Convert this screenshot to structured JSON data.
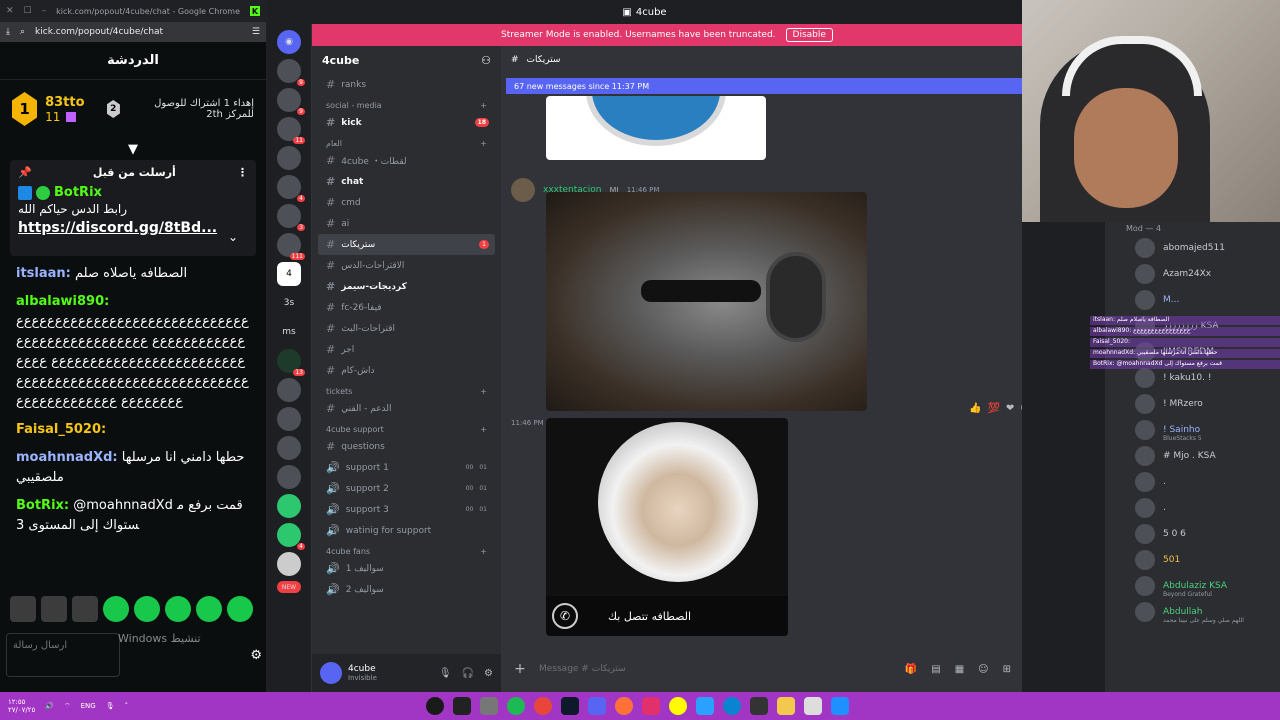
{
  "chrome": {
    "title": "kick.com/popout/4cube/chat - Google Chrome",
    "url": "kick.com/popout/4cube/chat"
  },
  "kick": {
    "header": "الدردشة",
    "leader": {
      "rank1": "1",
      "name": "83tto",
      "count": "11",
      "rank2": "2",
      "gift_text": "إهداء 1 اشتراك للوصول للمركز 2th"
    },
    "pinned": {
      "title": "أرسلت من قبل",
      "bot": "BotRix",
      "message": "رابط الدس حياكم الله",
      "link": "https://discord.gg/8tBd..."
    },
    "messages": [
      {
        "user": "itslaan:",
        "text": "الصطافه ياصلاه صلم"
      },
      {
        "user": "albalawi890:",
        "text": "ﻉﻉﻉﻉﻉﻉﻉﻉﻉﻉﻉﻉﻉﻉﻉﻉﻉﻉﻉﻉﻉﻉﻉﻉﻉﻉﻉﻉﻉﻉﻉﻉﻉﻉﻉﻉﻉﻉﻉﻉﻉﻉ ﻉﻉﻉﻉﻉﻉﻉﻉﻉﻉﻉﻉﻉﻉﻉﻉﻉﻉﻉﻉﻉﻉﻉﻉﻉﻉﻉﻉﻉﻉﻉﻉﻉﻉﻉﻉﻉﻉﻉﻉﻉﻉ ﻉﻉﻉﻉﻉﻉﻉﻉﻉﻉﻉﻉﻉﻉﻉﻉﻉﻉﻉﻉﻉﻉﻉﻉﻉﻉﻉﻉﻉﻉﻉﻉﻉﻉﻉﻉﻉﻉﻉﻉﻉﻉ ﻉﻉﻉﻉﻉﻉﻉﻉﻉﻉﻉﻉﻉ"
      },
      {
        "user": "Faisal_5020:",
        "text": ""
      },
      {
        "user": "moahnnadXd:",
        "text": "حطها دامني انا مرسلها ملصقيبي"
      },
      {
        "user": "BotRix:",
        "text": "@moahnnadXd قمت برفع مستواك إلى المستوى 3"
      }
    ],
    "send_placeholder": "ارسال رسالة",
    "watermark": "Windows تنشيط"
  },
  "discord": {
    "window_title": "4cube",
    "banner_text": "Streamer Mode is enabled. Usernames have been truncated.",
    "banner_button": "Disable",
    "guild_name": "4cube",
    "channels": [
      {
        "type": "text",
        "label": "ranks"
      },
      {
        "type": "category",
        "label": "social - media"
      },
      {
        "type": "text",
        "label": "kick",
        "bright": true,
        "mention": "18"
      },
      {
        "type": "category",
        "label": "العام"
      },
      {
        "type": "text",
        "label": "4cube ・لقطات"
      },
      {
        "type": "text",
        "label": "chat",
        "bright": true
      },
      {
        "type": "text",
        "label": "cmd"
      },
      {
        "type": "text",
        "label": "ai"
      },
      {
        "type": "text",
        "label": "ستريكات",
        "active": true,
        "mention": "1"
      },
      {
        "type": "text",
        "label": "الاقتراحات-الدس"
      },
      {
        "type": "text",
        "label": "كرديجات-سيمز",
        "bright": true
      },
      {
        "type": "text",
        "label": "fc-26-فيفا"
      },
      {
        "type": "text",
        "label": "اقتراحات-البث"
      },
      {
        "type": "text",
        "label": "اجر"
      },
      {
        "type": "text",
        "label": "داش-كام"
      },
      {
        "type": "category",
        "label": "tickets"
      },
      {
        "type": "text",
        "label": "الدعم - الفني"
      },
      {
        "type": "category",
        "label": "4cube support"
      },
      {
        "type": "text",
        "label": "questions"
      },
      {
        "type": "voice",
        "label": "support 1",
        "a": "00",
        "b": "01"
      },
      {
        "type": "voice",
        "label": "support 2",
        "a": "00",
        "b": "01"
      },
      {
        "type": "voice",
        "label": "support 3",
        "a": "00",
        "b": "01"
      },
      {
        "type": "voice",
        "label": "watinig for support"
      },
      {
        "type": "category",
        "label": "4cube fans"
      },
      {
        "type": "voice",
        "label": "سواليف 1"
      },
      {
        "type": "voice",
        "label": "سواليف 2"
      }
    ],
    "user": {
      "name": "4cube",
      "status": "Invisible"
    },
    "channel_header": "ستريكات",
    "new_messages": "67 new messages since 11:37 PM",
    "message": {
      "author": "xxxtentacion",
      "tag": "MJ",
      "time": "11:46 PM"
    },
    "second_time": "11:46 PM",
    "call_caption": "الصطافه تتصل بك",
    "composer_placeholder": "Message # ستريكات",
    "server_badges": [
      "9",
      "9",
      "11",
      "4",
      "3",
      "111",
      "13",
      "3s",
      "ms",
      "13",
      "4",
      "NEW"
    ]
  },
  "members": {
    "category": "Mod — 4",
    "list": [
      {
        "name": "abomajed511",
        "color": "default"
      },
      {
        "name": "Azam24Xx",
        "color": "default"
      },
      {
        "name": "M...",
        "color": "blue"
      },
      {
        "name": "زززززززز KSA",
        "color": "default"
      },
      {
        "name": "I'MS7REDM",
        "color": "default"
      },
      {
        "name": "! kaku10. !",
        "color": "default"
      },
      {
        "name": "! MRzero",
        "color": "default"
      },
      {
        "name": "! Sainho",
        "sub": "BlueStacks 5",
        "color": "blue"
      },
      {
        "name": "# Mjo . KSA",
        "color": "default"
      },
      {
        "name": ".",
        "color": "default"
      },
      {
        "name": ".",
        "color": "default"
      },
      {
        "name": "5 0 6",
        "color": "default"
      },
      {
        "name": "501",
        "color": "yellow"
      },
      {
        "name": "Abdulaziz KSA",
        "sub": "Beyond Grateful",
        "color": "green"
      },
      {
        "name": "Abdullah",
        "sub": "اللهم صلي وسلم على نبينا محمد",
        "color": "green"
      }
    ]
  },
  "overlay_chat": [
    "itslaan: الصطافه ياصلام صلم",
    "albalawi890: ﻉﻉﻉﻉﻉﻉﻉﻉﻉﻉﻉﻉﻉﻉﻉﻉ",
    "Faisal_5020:",
    "moahnnadXd: حطها دامني انا مرسلها ملصقيبي",
    "BotRix: @moahnnadXd قمت برفع مستواك إلى"
  ],
  "taskbar": {
    "time": "١٢:٥٥",
    "date": "٢٧/٠٧/٢٥",
    "lang": "ENG"
  }
}
